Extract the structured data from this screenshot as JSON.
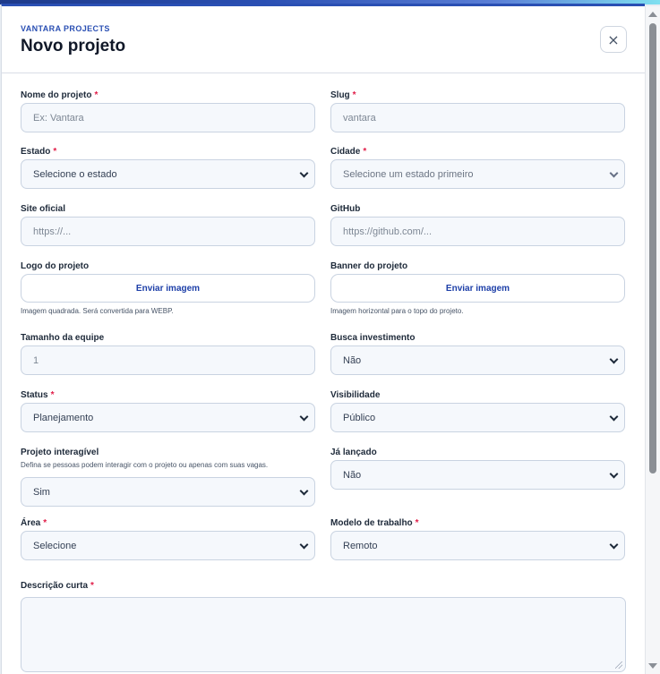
{
  "header": {
    "eyebrow": "VANTARA PROJECTS",
    "title": "Novo projeto",
    "close_symbol": "×"
  },
  "required_mark": "*",
  "fields": {
    "nome": {
      "label": "Nome do projeto",
      "placeholder": "Ex: Vantara"
    },
    "slug": {
      "label": "Slug",
      "placeholder": "vantara"
    },
    "estado": {
      "label": "Estado",
      "value": "Selecione o estado"
    },
    "cidade": {
      "label": "Cidade",
      "value": "Selecione um estado primeiro"
    },
    "site": {
      "label": "Site oficial",
      "placeholder": "https://..."
    },
    "github": {
      "label": "GitHub",
      "placeholder": "https://github.com/..."
    },
    "logo": {
      "label": "Logo do projeto",
      "button": "Enviar imagem",
      "hint": "Imagem quadrada. Será convertida para WEBP."
    },
    "banner": {
      "label": "Banner do projeto",
      "button": "Enviar imagem",
      "hint": "Imagem horizontal para o topo do projeto."
    },
    "equipe": {
      "label": "Tamanho da equipe",
      "value": "1"
    },
    "investimento": {
      "label": "Busca investimento",
      "value": "Não"
    },
    "status": {
      "label": "Status",
      "value": "Planejamento"
    },
    "visibilidade": {
      "label": "Visibilidade",
      "value": "Público"
    },
    "interagivel": {
      "label": "Projeto interagível",
      "hint": "Defina se pessoas podem interagir com o projeto ou apenas com suas vagas.",
      "value": "Sim"
    },
    "lancado": {
      "label": "Já lançado",
      "value": "Não"
    },
    "area": {
      "label": "Área",
      "value": "Selecione"
    },
    "modelo": {
      "label": "Modelo de trabalho",
      "value": "Remoto"
    },
    "descricao": {
      "label": "Descrição curta"
    }
  },
  "colors": {
    "accent": "#2a4fb3",
    "required": "#e11d48",
    "input_bg": "#f5f8fc",
    "input_border": "#c9d3e1"
  }
}
